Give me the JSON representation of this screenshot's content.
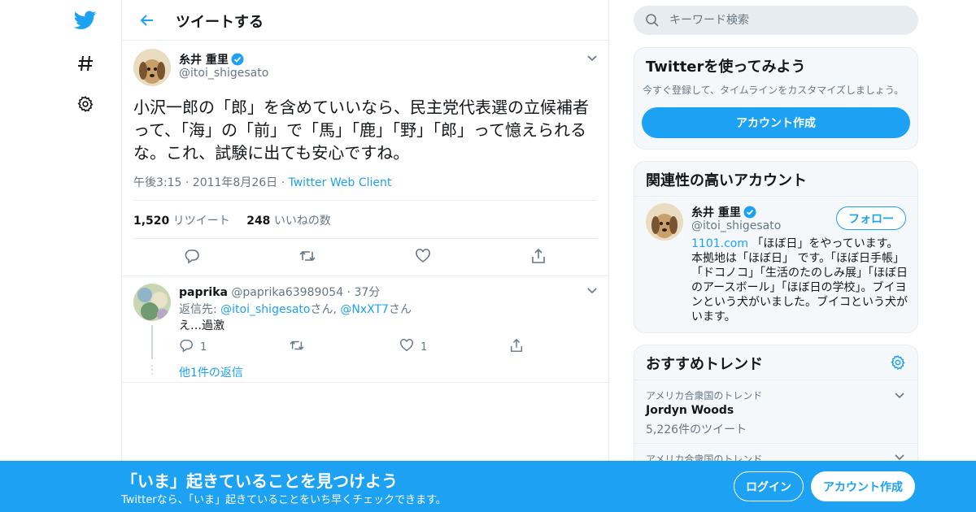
{
  "nav": {
    "logo_icon": "twitter-bird-icon",
    "explore_icon": "hashtag-icon",
    "settings_icon": "gear-icon"
  },
  "header": {
    "title": "ツイートする"
  },
  "tweet": {
    "name": "糸井 重里",
    "handle": "@itoi_shigesato",
    "text": "小沢一郎の「郎」を含めていいなら、民主党代表選の立候補者って、「海」の「前」で「馬」「鹿」「野」「郎」って憶えられるな。これ、試験に出ても安心ですね。",
    "time": "午後3:15 · 2011年8月26日 · ",
    "client": "Twitter Web Client",
    "retweets": "1,520",
    "retweets_label": "リツイート",
    "likes": "248",
    "likes_label": "いいねの数"
  },
  "reply": {
    "name": "paprika",
    "handle": "@paprika63989054",
    "time": "· 37分",
    "replying_prefix": "返信先: ",
    "reply_to_1": "@itoi_shigesato",
    "reply_to_sep": "さん, ",
    "reply_to_2": "@NxXT7",
    "reply_to_suffix": "さん",
    "text": "え…過激",
    "reply_count": "1",
    "like_count": "1",
    "more_replies": "他1件の返信"
  },
  "search": {
    "placeholder": "キーワード検索"
  },
  "signup_card": {
    "title": "Twitterを使ってみよう",
    "subtitle": "今すぐ登録して、タイムラインをカスタマイズしましょう。",
    "button": "アカウント作成"
  },
  "related_card": {
    "title": "関連性の高いアカウント",
    "name": "糸井 重里",
    "handle": "@itoi_shigesato",
    "follow_button": "フォロー",
    "bio_link": "1101.com",
    "bio_text": " 「ほぼ日」をやっています。本拠地は「ほぼ日」 です。「ほぼ日手帳」「ドコノコ」「生活のたのしみ展」「ほぼ日のアースボール」「ほぼ日の学校」。ブイヨンという犬がいました。ブイコという犬がいます。"
  },
  "trends_card": {
    "title": "おすすめトレンド",
    "trends": [
      {
        "location": "アメリカ合衆国のトレンド",
        "name": "Jordyn Woods",
        "count": "5,226件のツイート"
      },
      {
        "location": "アメリカ合衆国のトレンド",
        "name": "",
        "count": ""
      }
    ]
  },
  "bottom_bar": {
    "title": "「いま」起きていることを見つけよう",
    "subtitle": "Twitterなら、「いま」起きていることをいち早くチェックできます。",
    "login": "ログイン",
    "signup": "アカウント作成"
  },
  "colors": {
    "accent": "#1da1f2",
    "text": "#14171a",
    "muted": "#657786",
    "border": "#e6ecf0",
    "card_bg": "#f5f8fa"
  }
}
